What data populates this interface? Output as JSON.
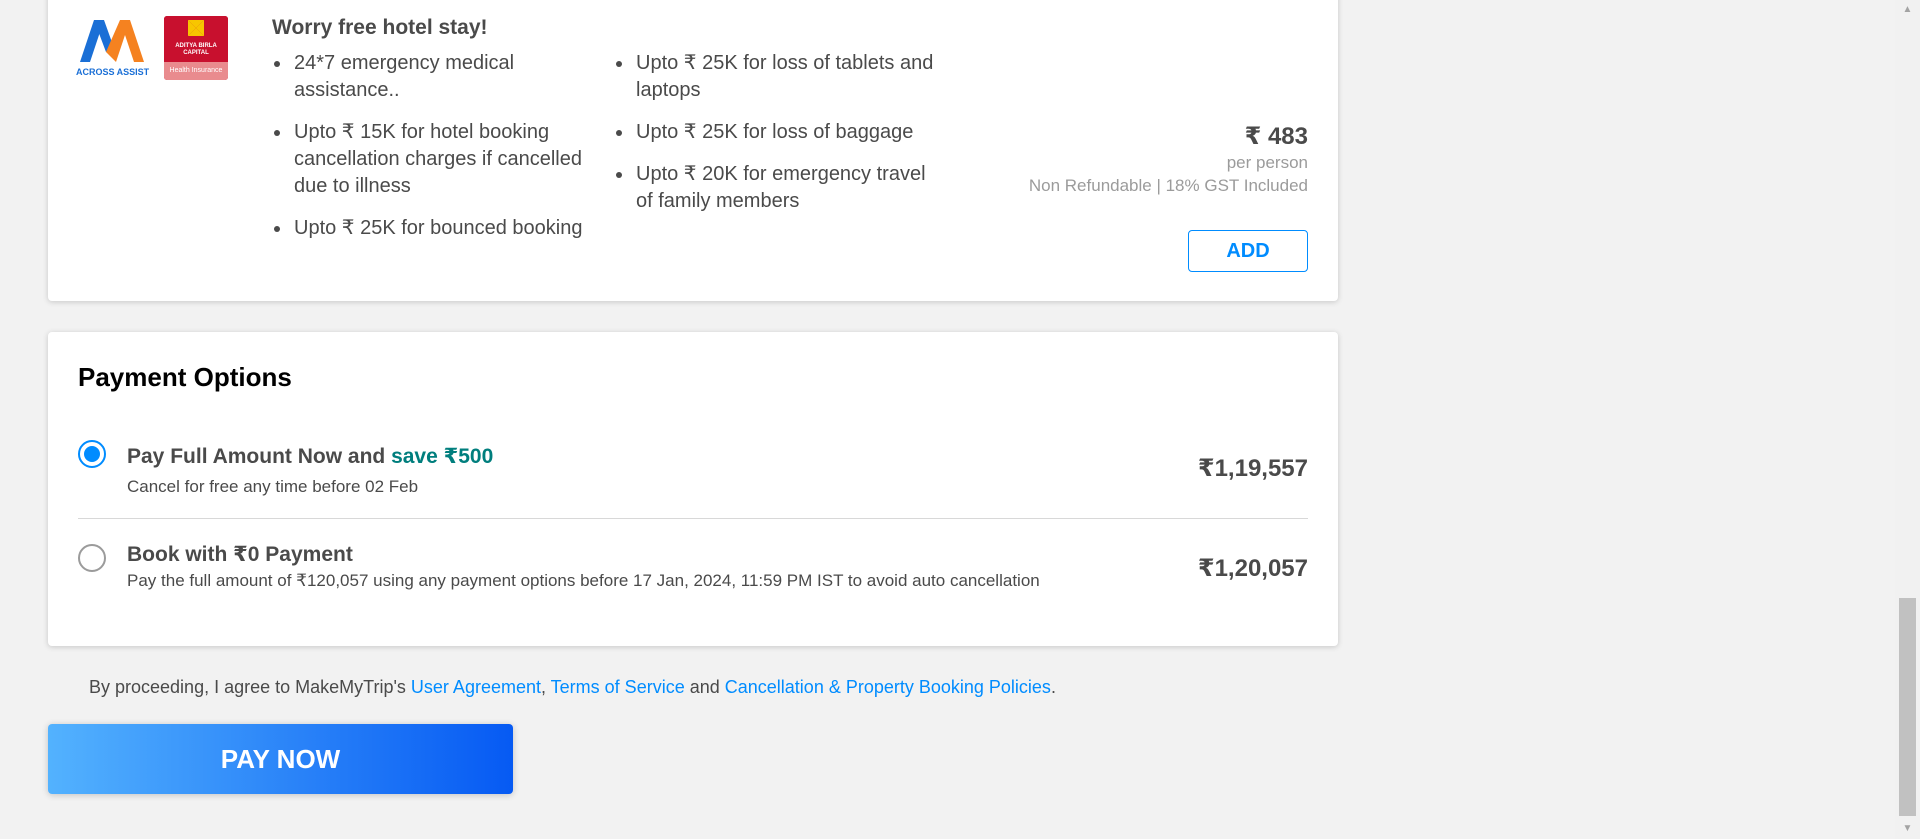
{
  "insurance": {
    "title": "Worry free hotel stay!",
    "logo_across": "ACROSS ASSIST",
    "logo_abc_lines": [
      "ADITYA BIRLA",
      "CAPITAL"
    ],
    "logo_abc_sub": "Health Insurance",
    "benefits_col1": [
      "24*7 emergency medical assistance..",
      "Upto ₹ 15K for hotel booking cancellation charges if cancelled due to illness",
      "Upto ₹ 25K for bounced booking"
    ],
    "benefits_col2": [
      "Upto ₹ 25K for loss of tablets and laptops",
      "Upto ₹ 25K for loss of baggage",
      "Upto ₹ 20K for emergency travel of family members"
    ],
    "price": "₹ 483",
    "per": "per person",
    "note": "Non Refundable | 18% GST Included",
    "add_label": "ADD"
  },
  "payment": {
    "title": "Payment Options",
    "options": [
      {
        "title": "Pay Full Amount Now and ",
        "highlight": "save ₹500",
        "sub": "Cancel for free any time before 02 Feb",
        "amount": "₹1,19,557",
        "selected": true
      },
      {
        "title": "Book with ₹0 Payment",
        "highlight": "",
        "sub": "Pay the full amount of ₹120,057 using any payment options before 17 Jan, 2024, 11:59 PM IST to avoid auto cancellation",
        "amount": "₹1,20,057",
        "selected": false
      }
    ]
  },
  "agreement": {
    "prefix": "By proceeding, I agree to MakeMyTrip's ",
    "link1": "User Agreement",
    "sep1": ", ",
    "link2": "Terms of Service",
    "sep2": " and ",
    "link3": "Cancellation & Property Booking Policies",
    "suffix": "."
  },
  "pay_now_label": "PAY NOW",
  "colors": {
    "accent": "#008cff",
    "save_green": "#007e7d",
    "gradient_start": "#53b2fe",
    "gradient_end": "#065af3"
  }
}
